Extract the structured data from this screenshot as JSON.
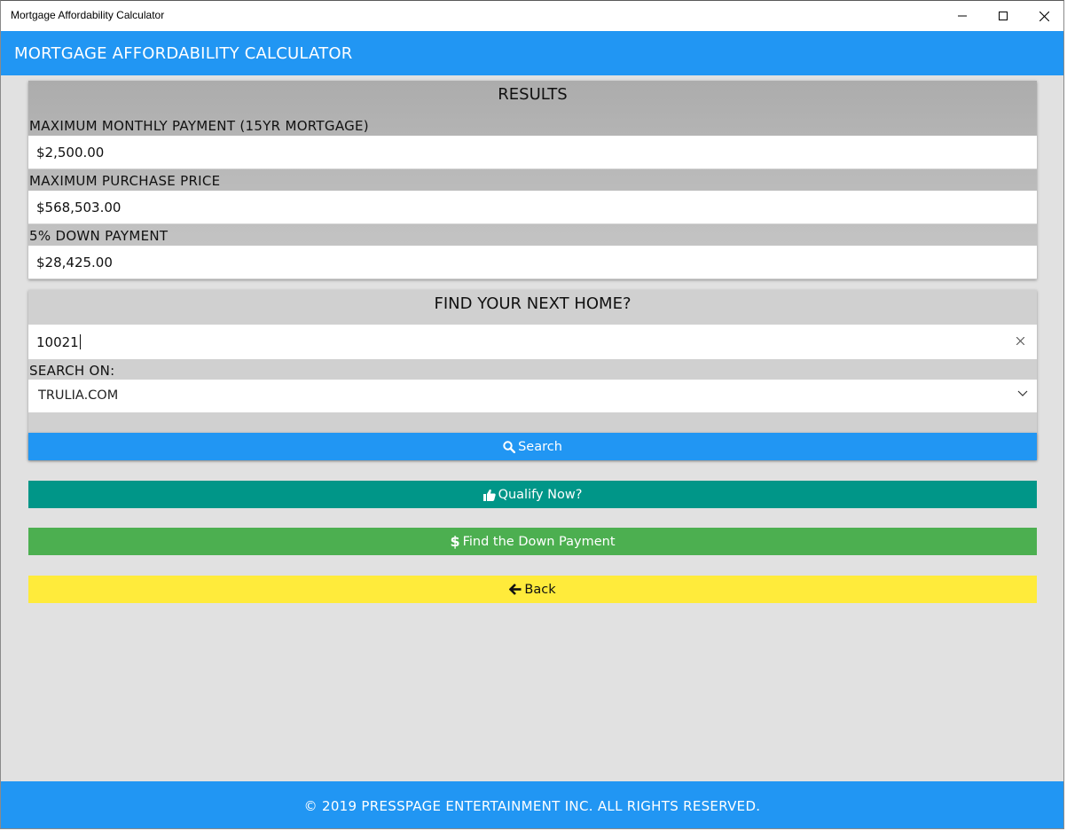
{
  "window": {
    "title": "Mortgage Affordability Calculator"
  },
  "appbar": {
    "title": "MORTGAGE AFFORDABILITY CALCULATOR"
  },
  "results": {
    "heading": "RESULTS",
    "fields": [
      {
        "label": "MAXIMUM MONTHLY PAYMENT (15YR MORTGAGE)",
        "value": "$2,500.00"
      },
      {
        "label": "MAXIMUM PURCHASE PRICE",
        "value": "$568,503.00"
      },
      {
        "label": "5% DOWN PAYMENT",
        "value": "$28,425.00"
      }
    ]
  },
  "search": {
    "heading": "FIND YOUR NEXT HOME?",
    "zip_value": "10021",
    "search_on_label": "SEARCH ON:",
    "site_selected": "TRULIA.COM",
    "search_button": "Search"
  },
  "buttons": {
    "qualify": "Qualify Now?",
    "down_payment": "Find the Down Payment",
    "back": "Back"
  },
  "footer": {
    "text": "© 2019 PRESSPAGE ENTERTAINMENT INC. ALL RIGHTS RESERVED."
  },
  "colors": {
    "primary_blue": "#2196f3",
    "teal": "#009688",
    "green": "#4caf50",
    "yellow": "#ffeb3b"
  },
  "icons": {
    "search": "search-icon",
    "qualify": "thumbs-up-icon",
    "down_payment": "dollar-icon",
    "back": "arrow-left-icon"
  }
}
